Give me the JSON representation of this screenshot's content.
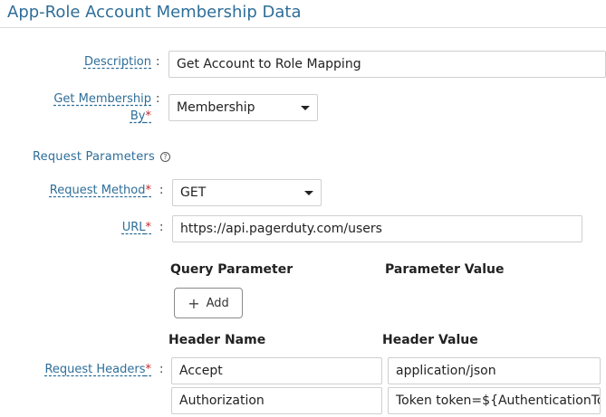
{
  "header": {
    "title": "App-Role Account Membership Data"
  },
  "form": {
    "description": {
      "label": "Description",
      "value": "Get Account to Role Mapping"
    },
    "get_membership_by": {
      "label_line1": "Get Membership",
      "label_line2": "By",
      "required_mark": "*",
      "value": "Membership"
    },
    "request_parameters": {
      "label": "Request Parameters",
      "help_icon": "?"
    },
    "request_method": {
      "label": "Request Method",
      "required_mark": "*",
      "value": "GET"
    },
    "url": {
      "label": "URL",
      "required_mark": "*",
      "value": "https://api.pagerduty.com/users"
    },
    "query": {
      "col_param": "Query Parameter",
      "col_value": "Parameter Value",
      "add_label": "Add",
      "add_icon": "+"
    },
    "headers": {
      "label": "Request Headers",
      "required_mark": "*",
      "col_name": "Header Name",
      "col_value": "Header Value",
      "rows": [
        {
          "name": "Accept",
          "value": "application/json"
        },
        {
          "name": "Authorization",
          "value": "Token token=${AuthenticationToken}"
        }
      ]
    },
    "colon": ":"
  },
  "colors": {
    "accent": "#2e6e99",
    "required": "#c62828"
  }
}
